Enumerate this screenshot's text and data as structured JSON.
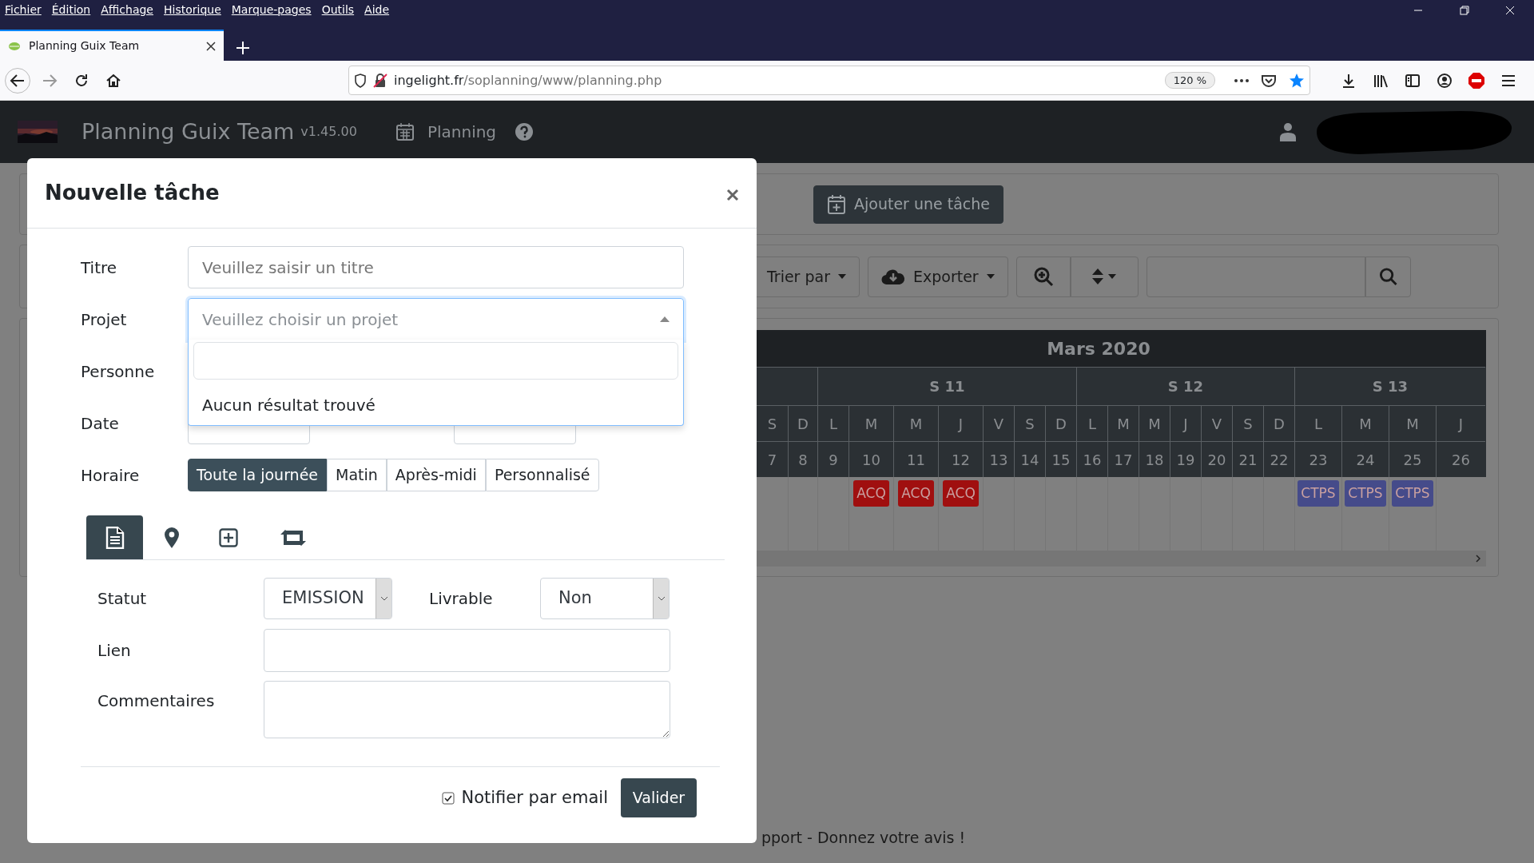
{
  "browser": {
    "menu": [
      "Fichier",
      "Édition",
      "Affichage",
      "Historique",
      "Marque-pages",
      "Outils",
      "Aide"
    ],
    "tab": {
      "title": "Planning Guix Team"
    },
    "url": {
      "host": "ingelight.fr",
      "path": "/soplanning/www/planning.php",
      "zoom": "120 %",
      "bookmarked": true
    }
  },
  "app_navbar": {
    "brand": "Planning Guix Team",
    "version": "v1.45.00",
    "menu": "Planning"
  },
  "toolbar": {
    "add_button": "Ajouter une tâche",
    "sort_button": "Trier par",
    "export_button": "Exporter"
  },
  "calendar": {
    "month": "Mars 2020",
    "weeks": [
      {
        "days": [
          {
            "letter": "S",
            "number": "7"
          },
          {
            "letter": "D",
            "number": "8"
          }
        ]
      },
      {
        "label": "S 11",
        "days": [
          {
            "letter": "L",
            "number": "9"
          },
          {
            "letter": "M",
            "number": "10",
            "event": {
              "code": "ACQ",
              "color": "#a00f0f"
            }
          },
          {
            "letter": "M",
            "number": "11",
            "event": {
              "code": "ACQ",
              "color": "#a00f0f"
            }
          },
          {
            "letter": "J",
            "number": "12",
            "event": {
              "code": "ACQ",
              "color": "#a00f0f"
            }
          },
          {
            "letter": "V",
            "number": "13"
          },
          {
            "letter": "S",
            "number": "14"
          },
          {
            "letter": "D",
            "number": "15"
          }
        ]
      },
      {
        "label": "S 12",
        "days": [
          {
            "letter": "L",
            "number": "16"
          },
          {
            "letter": "M",
            "number": "17"
          },
          {
            "letter": "M",
            "number": "18"
          },
          {
            "letter": "J",
            "number": "19"
          },
          {
            "letter": "V",
            "number": "20"
          },
          {
            "letter": "S",
            "number": "21"
          },
          {
            "letter": "D",
            "number": "22"
          }
        ]
      },
      {
        "label": "S 13",
        "days": [
          {
            "letter": "L",
            "number": "23",
            "event": {
              "code": "CTPS",
              "color": "#454b8a"
            }
          },
          {
            "letter": "M",
            "number": "24",
            "event": {
              "code": "CTPS",
              "color": "#454b8a"
            }
          },
          {
            "letter": "M",
            "number": "25",
            "event": {
              "code": "CTPS",
              "color": "#454b8a"
            }
          },
          {
            "letter": "J",
            "number": "26"
          }
        ]
      }
    ]
  },
  "footer_text": "pport - Donnez votre avis !",
  "modal": {
    "title": "Nouvelle tâche",
    "titre": {
      "label": "Titre",
      "placeholder": "Veuillez saisir un titre"
    },
    "projet": {
      "label": "Projet",
      "placeholder": "Veuillez choisir un projet",
      "expanded": true,
      "no_results": "Aucun résultat trouvé"
    },
    "personne": {
      "label": "Personne"
    },
    "date": {
      "label": "Date"
    },
    "horaire": {
      "label": "Horaire",
      "options": [
        {
          "label": "Toute la journée",
          "selected": true
        },
        {
          "label": "Matin",
          "selected": false
        },
        {
          "label": "Après-midi",
          "selected": false
        },
        {
          "label": "Personnalisé",
          "selected": false
        }
      ]
    },
    "tabs": [
      {
        "kind": "document",
        "selected": true
      },
      {
        "kind": "location",
        "selected": false
      },
      {
        "kind": "add",
        "selected": false
      },
      {
        "kind": "repeat",
        "selected": false
      }
    ],
    "statut": {
      "label": "Statut",
      "value": "EMISSION"
    },
    "livrable": {
      "label": "Livrable",
      "value": "Non"
    },
    "lien": {
      "label": "Lien"
    },
    "commentaires": {
      "label": "Commentaires"
    },
    "notify": {
      "label": "Notifier par email",
      "checked": true
    },
    "submit": "Valider"
  }
}
